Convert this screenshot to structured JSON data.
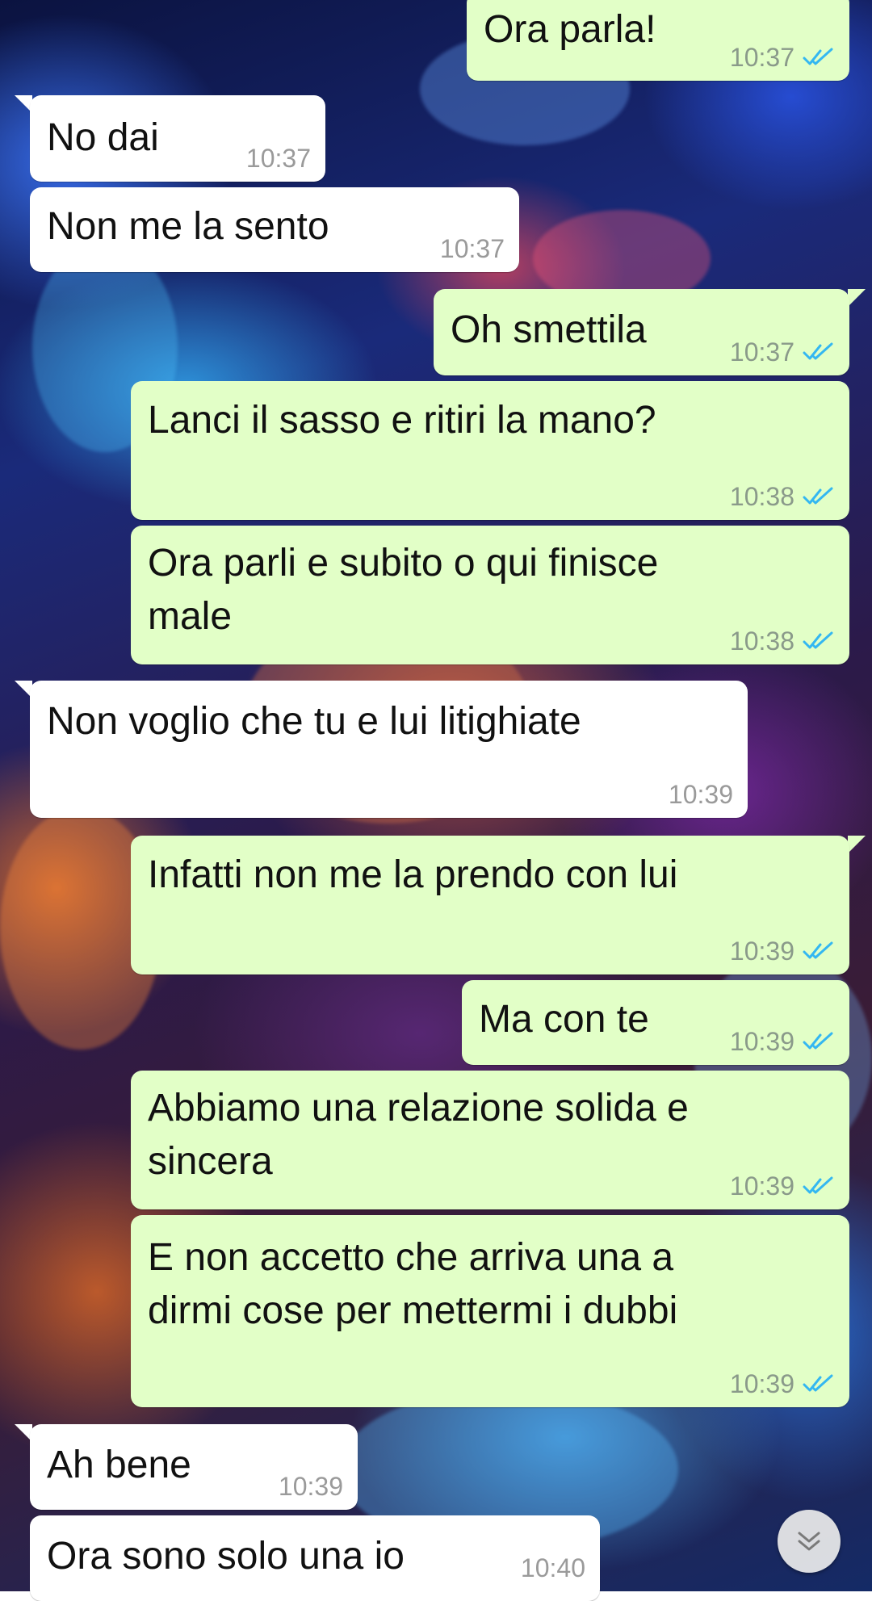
{
  "colors": {
    "outgoing_bubble": "#e2ffc7",
    "incoming_bubble": "#ffffff",
    "read_ticks": "#34b7f1"
  },
  "messages": [
    {
      "direction": "out",
      "text": "Ora parla!",
      "time": "10:37",
      "status": "read"
    },
    {
      "direction": "in",
      "text": "No dai",
      "time": "10:37"
    },
    {
      "direction": "in",
      "text": "Non me la sento",
      "time": "10:37"
    },
    {
      "direction": "out",
      "text": "Oh smettila",
      "time": "10:37",
      "status": "read"
    },
    {
      "direction": "out",
      "text": "Lanci il sasso e ritiri la mano?",
      "time": "10:38",
      "status": "read"
    },
    {
      "direction": "out",
      "text": "Ora parli e subito o qui finisce",
      "text_line2": "male",
      "time": "10:38",
      "status": "read"
    },
    {
      "direction": "in",
      "text": "Non voglio che tu e lui litighiate",
      "time": "10:39"
    },
    {
      "direction": "out",
      "text": "Infatti non me la prendo con lui",
      "time": "10:39",
      "status": "read"
    },
    {
      "direction": "out",
      "text": "Ma con te",
      "time": "10:39",
      "status": "read"
    },
    {
      "direction": "out",
      "text": "Abbiamo una relazione solida e",
      "text_line2": "sincera",
      "time": "10:39",
      "status": "read"
    },
    {
      "direction": "out",
      "text": "E non accetto che arriva una a",
      "text_line2": "dirmi cose per mettermi i dubbi",
      "time": "10:39",
      "status": "read"
    },
    {
      "direction": "in",
      "text": "Ah bene",
      "time": "10:39"
    },
    {
      "direction": "in",
      "text": "Ora sono solo una io",
      "time": "10:40"
    }
  ],
  "scroll_button": {
    "icon": "double-chevron-down-icon"
  }
}
